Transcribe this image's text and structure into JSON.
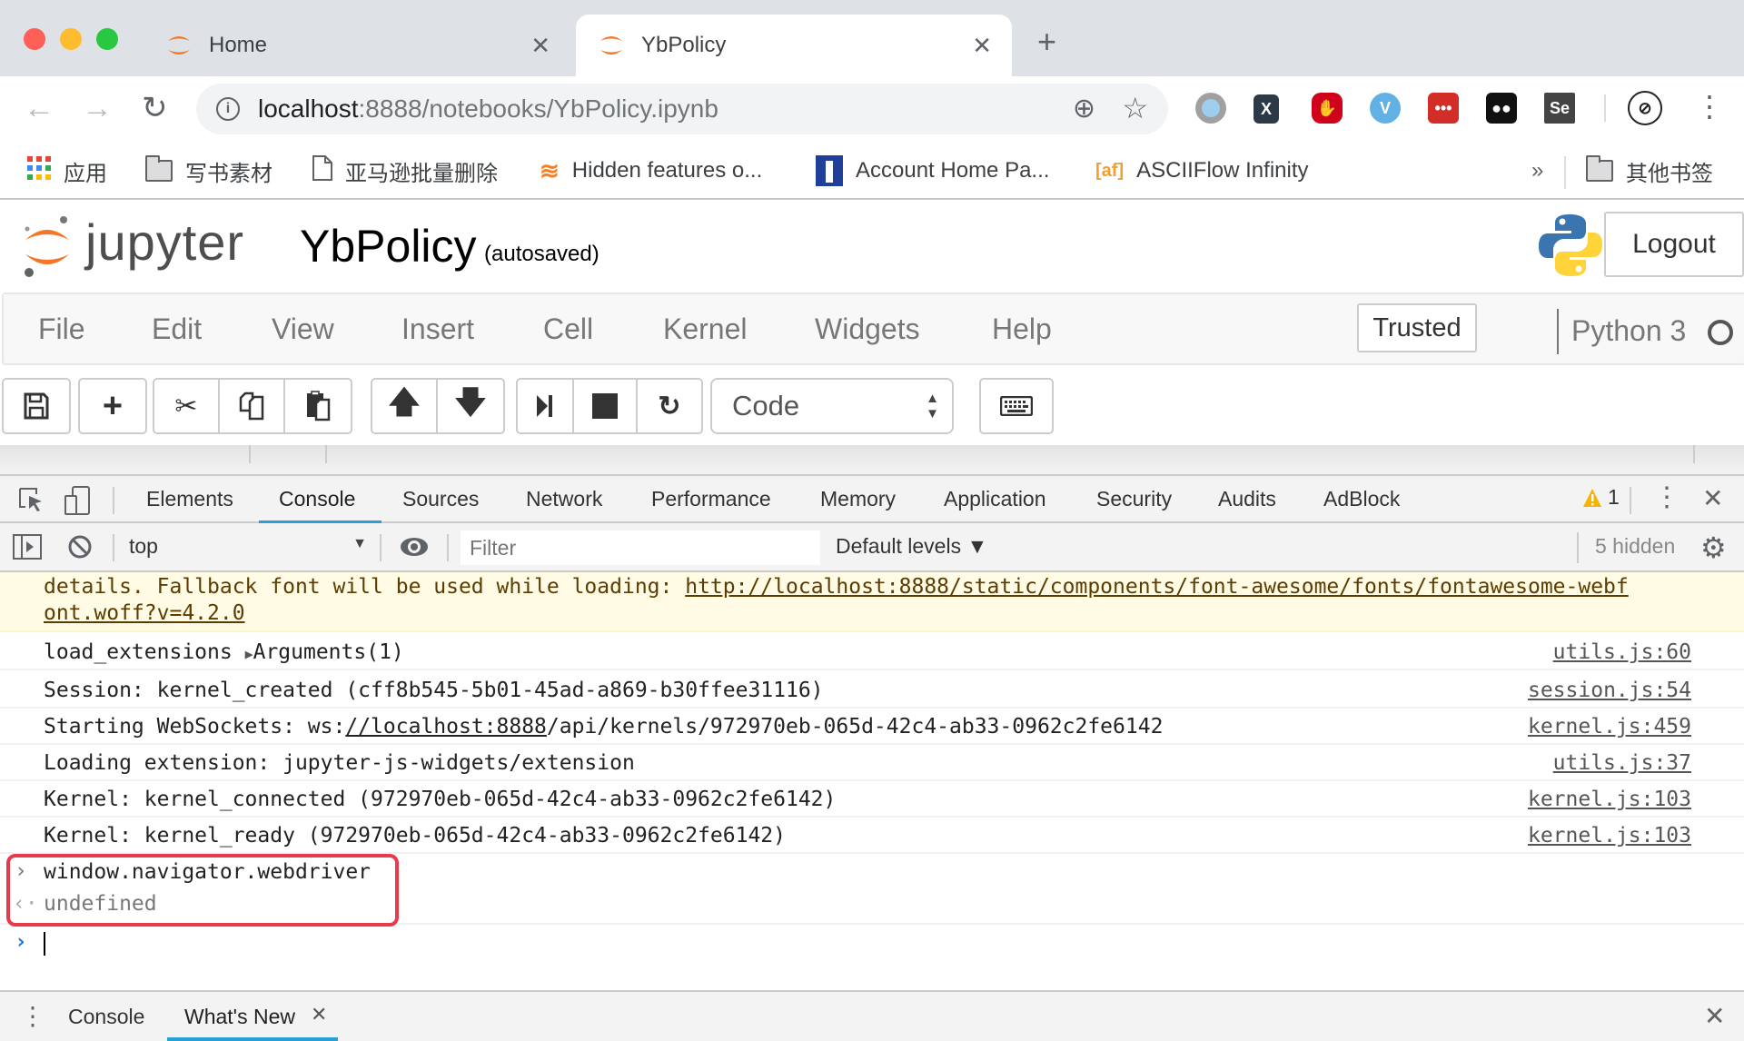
{
  "browser": {
    "tabs": [
      {
        "title": "Home",
        "active": false
      },
      {
        "title": "YbPolicy",
        "active": true
      }
    ],
    "new_tab_icon": "+",
    "url_host": "localhost",
    "url_rest": ":8888/notebooks/YbPolicy.ipynb",
    "extensions": [
      "circle-ext",
      "x-ext",
      "adblock-hand-ext",
      "vimeo-ext",
      "lastpass-ext",
      "dots-ext",
      "selenium-ide-ext",
      "no-tracking-ext"
    ],
    "bookmarks": [
      {
        "label": "应用",
        "icon": "apps-grid-icon"
      },
      {
        "label": "写书素材",
        "icon": "folder-icon"
      },
      {
        "label": "亚马逊批量删除",
        "icon": "page-icon"
      },
      {
        "label": "Hidden features o...",
        "icon": "stackoverflow-icon"
      },
      {
        "label": "Account Home Pa...",
        "icon": "bank-icon"
      },
      {
        "label": "ASCIIFlow Infinity",
        "icon": "af-icon"
      }
    ],
    "bookmarks_overflow": "»",
    "other_bookmarks": "其他书签"
  },
  "jupyter": {
    "logo_text": "jupyter",
    "notebook_title": "YbPolicy",
    "autosave_status": "(autosaved)",
    "logout_label": "Logout",
    "menu": [
      "File",
      "Edit",
      "View",
      "Insert",
      "Cell",
      "Kernel",
      "Widgets",
      "Help"
    ],
    "trusted_label": "Trusted",
    "kernel_name": "Python 3",
    "cell_type": "Code"
  },
  "devtools": {
    "tabs": [
      "Elements",
      "Console",
      "Sources",
      "Network",
      "Performance",
      "Memory",
      "Application",
      "Security",
      "Audits",
      "AdBlock"
    ],
    "active_tab": "Console",
    "warning_count": "1",
    "context": "top",
    "filter_placeholder": "Filter",
    "levels": "Default levels ▼",
    "hidden_count": "5 hidden",
    "warning_message": {
      "line1_text": "details. Fallback font will be used while loading: ",
      "line1_link": "http://localhost:8888/static/components/font-awesome/fonts/fontawesome-webf",
      "line2_link": "ont.woff?v=4.2.0"
    },
    "logs": [
      {
        "prefix": "load_extensions ",
        "expander": "▶",
        "suffix": "Arguments(1)",
        "source": "utils.js:60"
      },
      {
        "text": "Session: kernel_created (cff8b545-5b01-45ad-a869-b30ffee31116)",
        "source": "session.js:54"
      },
      {
        "prefix": "Starting WebSockets: ws:",
        "link": "//localhost:8888",
        "suffix": "/api/kernels/972970eb-065d-42c4-ab33-0962c2fe6142",
        "source": "kernel.js:459"
      },
      {
        "text": "Loading extension: jupyter-js-widgets/extension",
        "source": "utils.js:37"
      },
      {
        "text": "Kernel: kernel_connected (972970eb-065d-42c4-ab33-0962c2fe6142)",
        "source": "kernel.js:103"
      },
      {
        "text": "Kernel: kernel_ready (972970eb-065d-42c4-ab33-0962c2fe6142)",
        "source": "kernel.js:103"
      }
    ],
    "input_command": "window.navigator.webdriver",
    "result": "undefined",
    "drawer_tabs": [
      "Console",
      "What's New"
    ],
    "active_drawer_tab": "What's New"
  },
  "colors": {
    "jupyter_orange": "#f37726",
    "devtools_accent": "#2a9fd6",
    "highlight_red": "#e9394d",
    "warning_bg": "#fffbe5"
  }
}
